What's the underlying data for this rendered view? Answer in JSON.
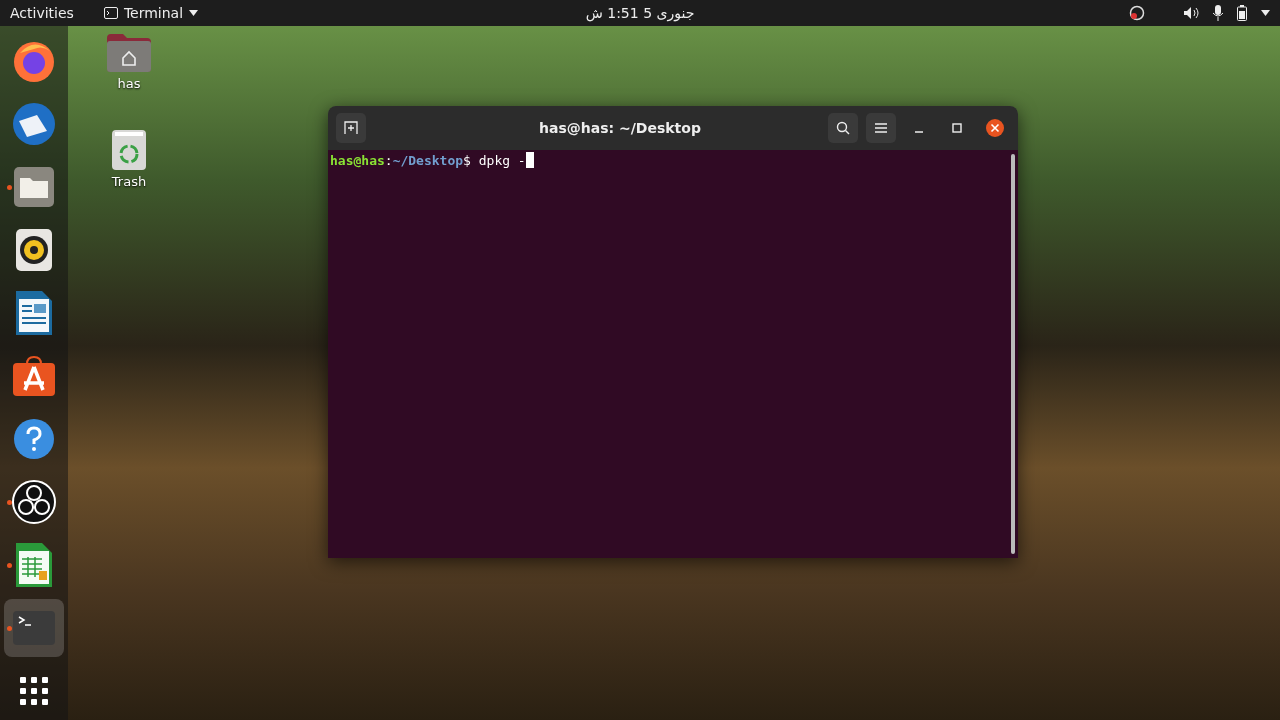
{
  "top_bar": {
    "activities": "Activities",
    "app_menu": "Terminal",
    "clock": "جنوری 5  1:51 ش"
  },
  "dock": [
    {
      "kind": "firefox",
      "running": false,
      "selected": false
    },
    {
      "kind": "thunderbird",
      "running": false,
      "selected": false
    },
    {
      "kind": "files",
      "running": true,
      "selected": false
    },
    {
      "kind": "rhythmbox",
      "running": false,
      "selected": false
    },
    {
      "kind": "writer",
      "running": false,
      "selected": false
    },
    {
      "kind": "software",
      "running": false,
      "selected": false
    },
    {
      "kind": "help",
      "running": false,
      "selected": false
    },
    {
      "kind": "obs",
      "running": true,
      "selected": false
    },
    {
      "kind": "calc",
      "running": true,
      "selected": false
    },
    {
      "kind": "terminal",
      "running": true,
      "selected": true
    },
    {
      "kind": "apps",
      "running": false,
      "selected": false
    }
  ],
  "desktop_icons": [
    {
      "kind": "home",
      "label": "has"
    },
    {
      "kind": "trash",
      "label": "Trash"
    }
  ],
  "terminal": {
    "title": "has@has: ~/Desktop",
    "prompt_user": "has@has",
    "prompt_sep": ":",
    "prompt_path": "~/Desktop",
    "prompt_symbol": "$",
    "command": " dpkg -"
  }
}
